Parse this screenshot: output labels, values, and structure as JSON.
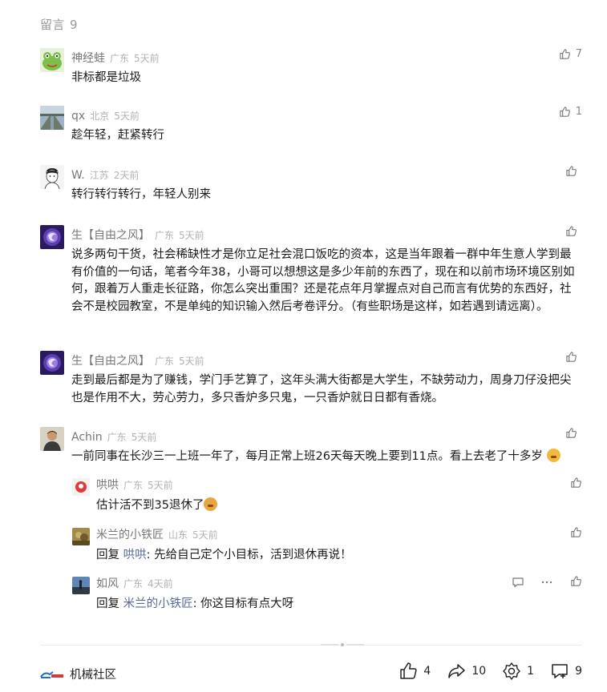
{
  "header": {
    "label": "留言",
    "count": "9"
  },
  "comments": [
    {
      "name": "神经蛙",
      "location": "广东",
      "time": "5天前",
      "likes": "7",
      "text": "非标都是垃圾"
    },
    {
      "name": "qx",
      "location": "北京",
      "time": "5天前",
      "likes": "1",
      "text": "趁年轻，赶紧转行"
    },
    {
      "name": "W.",
      "location": "江苏",
      "time": "2天前",
      "likes": "",
      "text": "转行转行转行，年轻人别来"
    },
    {
      "name": "生【自由之风】",
      "location": "广东",
      "time": "5天前",
      "likes": "",
      "text": "说多两句干货，社会稀缺性才是你立足社会混口饭吃的资本，这是当年跟着一群中年生意人学到最有价值的一句话，笔者今年38，小哥可以想想这是多少年前的东西了，现在和以前市场环境区别如何，跟着万人重走长征路，你怎么突出重围？还是花点年月掌握点对自己而言有优势的东西好，社会不是校园教室，不是单纯的知识输入然后考卷评分。（有些职场是这样，如若遇到请远离）。"
    },
    {
      "name": "生【自由之风】",
      "location": "广东",
      "time": "5天前",
      "likes": "",
      "text": "走到最后都是为了赚钱，学门手艺算了，这年头满大街都是大学生，不缺劳动力，周身刀仔没把尖也是作用不大，劳心劳力，多只香炉多只鬼，一只香炉就日日都有香烧。"
    },
    {
      "name": "Achin",
      "location": "广东",
      "time": "5天前",
      "likes": "",
      "text": "一前同事在长沙三一上班一年了，每月正常上班26天每天晚上要到11点。看上去老了十多岁"
    }
  ],
  "replies": [
    {
      "name": "哄哄",
      "location": "广东",
      "time": "5天前",
      "prefix": "",
      "target": "",
      "text": "估计活不到35退休了"
    },
    {
      "name": "米兰的小铁匠",
      "location": "山东",
      "time": "5天前",
      "prefix": "回复 ",
      "target": "哄哄",
      "text": ": 先给自己定个小目标，活到退休再说！"
    },
    {
      "name": "如风",
      "location": "广东",
      "time": "4天前",
      "prefix": "回复 ",
      "target": "米兰的小铁匠",
      "text": ": 你这目标有点大呀"
    }
  ],
  "footer": {
    "brand": "机械社区",
    "likes": "4",
    "shares": "10",
    "wow": "1",
    "comments": "9"
  },
  "colors": {
    "link": "#576b95",
    "meta": "#b2b2b2",
    "name": "#777777"
  }
}
